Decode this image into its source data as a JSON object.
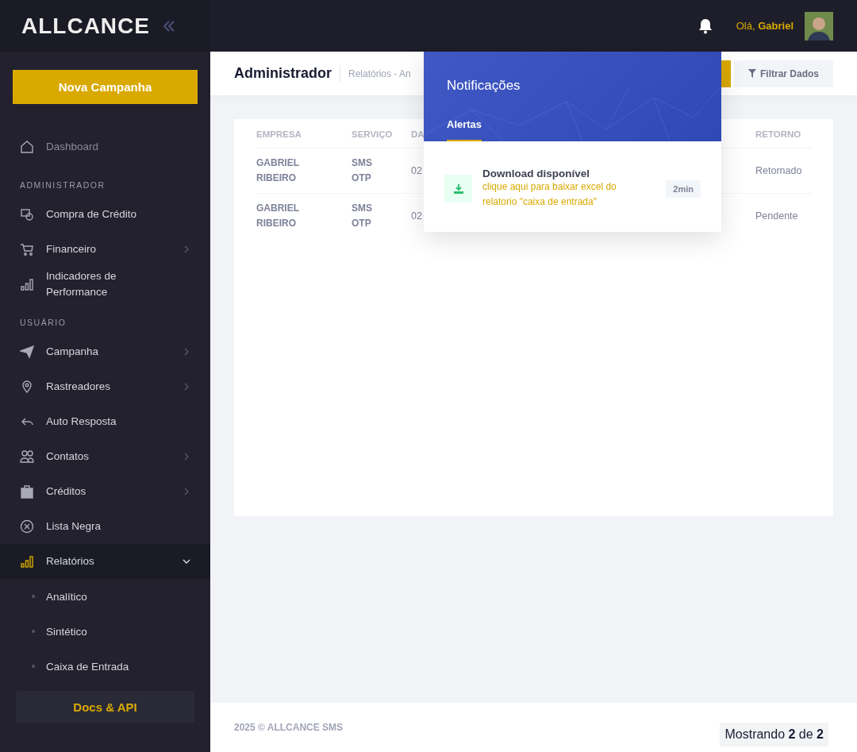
{
  "topbar": {
    "logo": "ALLCANCE",
    "greeting": "Olá,",
    "user": "Gabriel"
  },
  "sidebar": {
    "button": "Nova Campanha",
    "items": [
      {
        "kind": "link",
        "label": "Dashboard",
        "selected": false
      },
      {
        "kind": "section",
        "label": "ADMINISTRADOR"
      },
      {
        "kind": "link",
        "label": "Compra de Crédito",
        "selected": false
      },
      {
        "kind": "group",
        "label": "Financeiro",
        "selected": false,
        "expanded": false
      },
      {
        "kind": "link",
        "label": "Indicadores de Performance",
        "selected": false
      },
      {
        "kind": "section",
        "label": "USUÁRIO"
      },
      {
        "kind": "group",
        "label": "Campanha",
        "selected": false,
        "expanded": false
      },
      {
        "kind": "group",
        "label": "Rastreadores",
        "selected": false,
        "expanded": false
      },
      {
        "kind": "link",
        "label": "Auto Resposta",
        "selected": false
      },
      {
        "kind": "group",
        "label": "Contatos",
        "selected": false,
        "expanded": false
      },
      {
        "kind": "group",
        "label": "Créditos",
        "selected": false,
        "expanded": false
      },
      {
        "kind": "link",
        "label": "Lista Negra",
        "selected": false
      },
      {
        "kind": "group",
        "label": "Relatórios",
        "selected": true,
        "expanded": true,
        "children": [
          {
            "label": "Analítico",
            "selected": false
          },
          {
            "label": "Sintético",
            "selected": false
          },
          {
            "label": "Caixa de Entrada",
            "selected": false
          }
        ]
      }
    ],
    "docs": "Docs & API"
  },
  "subheader": {
    "title": "Administrador",
    "breadcrumb": "Relatórios - An",
    "filter": "Filtrar Dados"
  },
  "table": {
    "columns": [
      "EMPRESA",
      "SERVIÇO",
      "DA",
      "RETORNO"
    ],
    "rows": [
      {
        "cells": [
          "GABRIEL RIBEIRO",
          "SMS OTP",
          "02",
          "Retornado"
        ]
      },
      {
        "cells": [
          "GABRIEL RIBEIRO",
          "SMS OTP",
          "02",
          "Pendente"
        ]
      }
    ]
  },
  "notifications": {
    "title": "Notificações",
    "tabs": [
      {
        "label": "Alertas",
        "selected": true
      }
    ],
    "items": [
      {
        "title": "Download disponível",
        "text": "clique aqui para baixar excel do relatorio \"caixa de entrada\"",
        "time": "2min"
      }
    ]
  },
  "footer": {
    "copyright": "2025 © ALLCANCE SMS",
    "pager": "Mostrando **2** de **2**"
  }
}
